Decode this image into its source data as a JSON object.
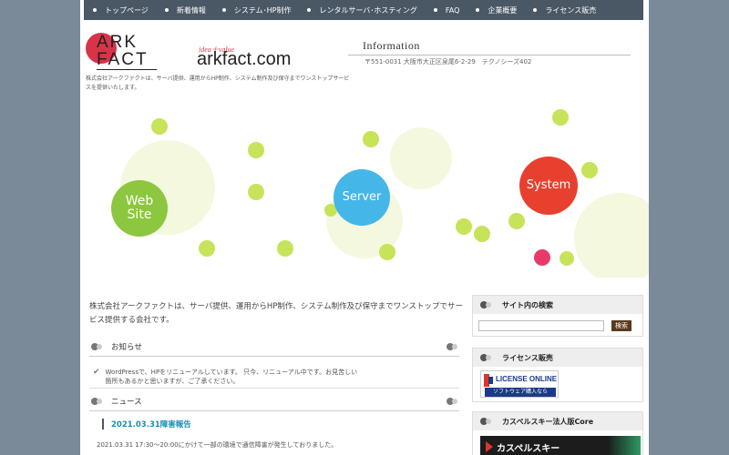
{
  "nav": {
    "items": [
      {
        "label": "トップページ"
      },
      {
        "label": "新着情報"
      },
      {
        "label": "システム･HP制作"
      },
      {
        "label": "レンタルサーバ･ホスティング"
      },
      {
        "label": "FAQ"
      },
      {
        "label": "企業概要"
      },
      {
        "label": "ライセンス販売"
      }
    ]
  },
  "header": {
    "logo_top": "ARK",
    "logo_bottom": "FACT",
    "tagline": "idea＋value",
    "domain": "arkfact.com",
    "description": "株式会社アークファクトは、サーバ提供、運用からHP制作、システム制作及び保守までワンストップサービスを提供いたします。",
    "info_title": "Information",
    "address": "〒551-0031 大阪市大正区泉尾6-2-29　テクノシーズ402"
  },
  "hero": {
    "web_line1": "Web",
    "web_line2": "Site",
    "server": "Server",
    "system": "System",
    "colors": {
      "web": "#8dc63f",
      "server": "#45b6e8",
      "system": "#e8402e",
      "lime": "#c6e35a",
      "pale": "#f3f8df",
      "pink": "#e83a6a"
    }
  },
  "main": {
    "intro": "株式会社アークファクトは、サーバ提供、運用からHP制作、システム制作及び保守までワンストップでサービス提供する会社です。",
    "notice_title": "お知らせ",
    "notice_text": "WordPressで、HPをリニューアルしています。 只今、リニューアル中です。お見苦しい箇所もあるかと思いますが、ご了承ください。",
    "news_title": "ニュース",
    "news_date_title": "2021.03.31障害報告",
    "news_body": "2021.03.31 17:30～20:00にかけて一部の環境で通信障害が発生しておりました。"
  },
  "sidebar": {
    "search_title": "サイト内の検索",
    "search_placeholder": "",
    "search_button": "検索",
    "license_title": "ライセンス販売",
    "license_banner_top": "LICENSE ONLINE",
    "license_banner_bottom": "ソフトウェア購入なら",
    "kasp_title": "カスペルスキー法人版Core",
    "kasp_banner": "カスペルスキー"
  }
}
